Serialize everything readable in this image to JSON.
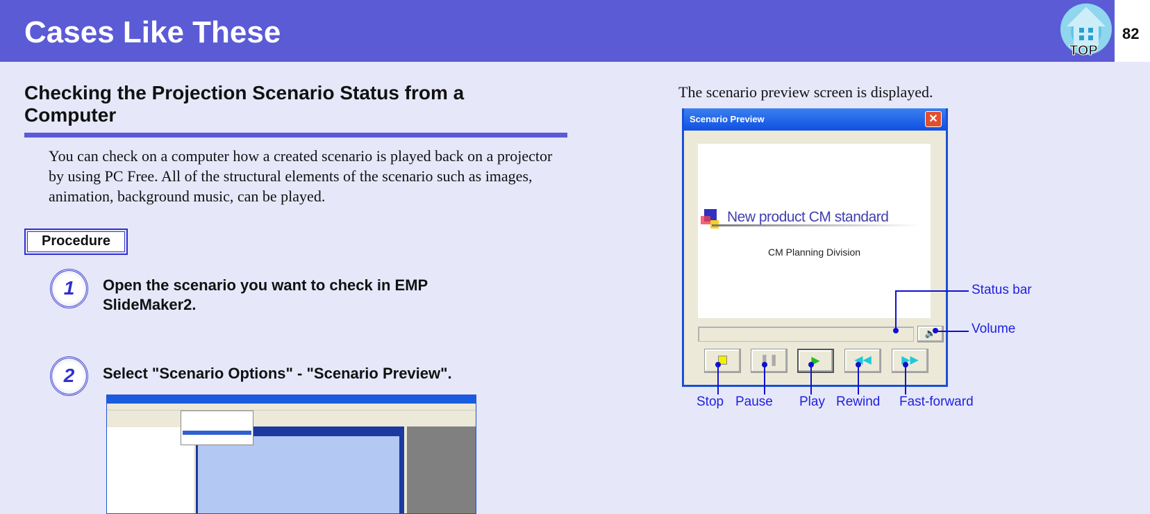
{
  "header": {
    "title": "Cases Like These",
    "page_number": "82",
    "top_icon_label": "TOP"
  },
  "section": {
    "heading": "Checking the Projection Scenario Status from a Computer",
    "intro": "You can check on a computer how a created scenario is played back on a projector by using PC Free. All of the structural elements of the scenario such as images, animation, background music, can be played."
  },
  "procedure_label": "Procedure",
  "steps": [
    {
      "number": "1",
      "text": "Open the scenario you want to check in EMP SlideMaker2."
    },
    {
      "number": "2",
      "text": "Select \"Scenario Options\" - \"Scenario Preview\"."
    }
  ],
  "right": {
    "text": "The scenario preview screen is displayed."
  },
  "dialog": {
    "title": "Scenario Preview",
    "close": "✕",
    "slide_title": "New product CM standard",
    "slide_subtitle": "CM Planning Division"
  },
  "callouts": {
    "status_bar": "Status bar",
    "volume": "Volume",
    "stop": "Stop",
    "pause": "Pause",
    "play": "Play",
    "rewind": "Rewind",
    "fast_forward": "Fast-forward"
  },
  "colors": {
    "header": "#5b5bd6",
    "background": "#e6e8fa",
    "callout": "#2020e0"
  }
}
